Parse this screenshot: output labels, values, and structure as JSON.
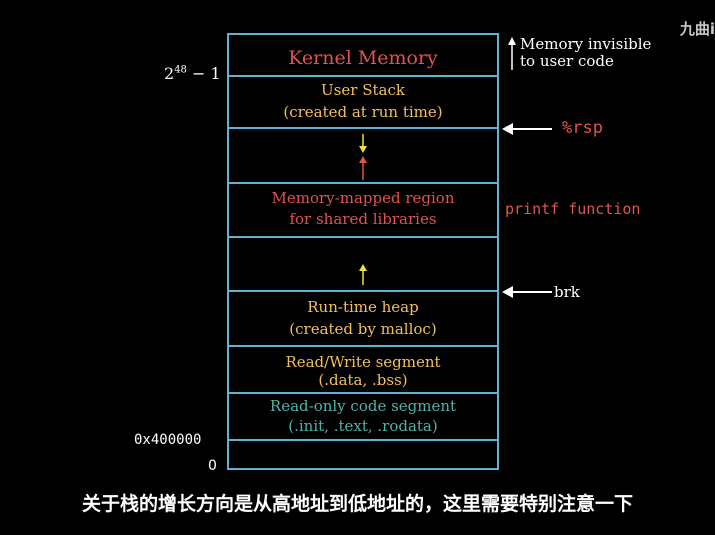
{
  "colors": {
    "border": "#5fb2d6",
    "kernel": "#e0534f",
    "user_stack": "#f0c05a",
    "mmap": "#e0534f",
    "heap": "#f0c05a",
    "rw": "#f0c05a",
    "ro": "#4fb3a8",
    "stack_arrow": "#f0e03a",
    "mmap_arrow": "#e0534f",
    "heap_arrow": "#f0e03a",
    "pointer_arrow": "#ffffff",
    "label_red": "#e0534f"
  },
  "watermark": "九曲i",
  "addresses": {
    "top_base": "2",
    "top_exp": "48",
    "top_rest": " − 1",
    "text_start": "0x400000",
    "zero": "0"
  },
  "segments": {
    "kernel": "Kernel Memory",
    "user_stack_line1": "User Stack",
    "user_stack_line2": "(created at run time)",
    "mmap_line1": "Memory-mapped region",
    "mmap_line2": "for shared libraries",
    "heap_line1": "Run-time heap",
    "heap_line2": "(created by malloc)",
    "rw_line1": "Read/Write segment",
    "rw_line2": "(.data, .bss)",
    "ro_line1": "Read-only code segment",
    "ro_line2": "(.init, .text, .rodata)"
  },
  "annotations": {
    "invisible_line1": "Memory invisible",
    "invisible_line2": "to user code",
    "rsp": "%rsp",
    "printf": "printf function",
    "brk": "brk"
  },
  "subtitle": "关于栈的增长方向是从高地址到低地址的，这里需要特别注意一下"
}
